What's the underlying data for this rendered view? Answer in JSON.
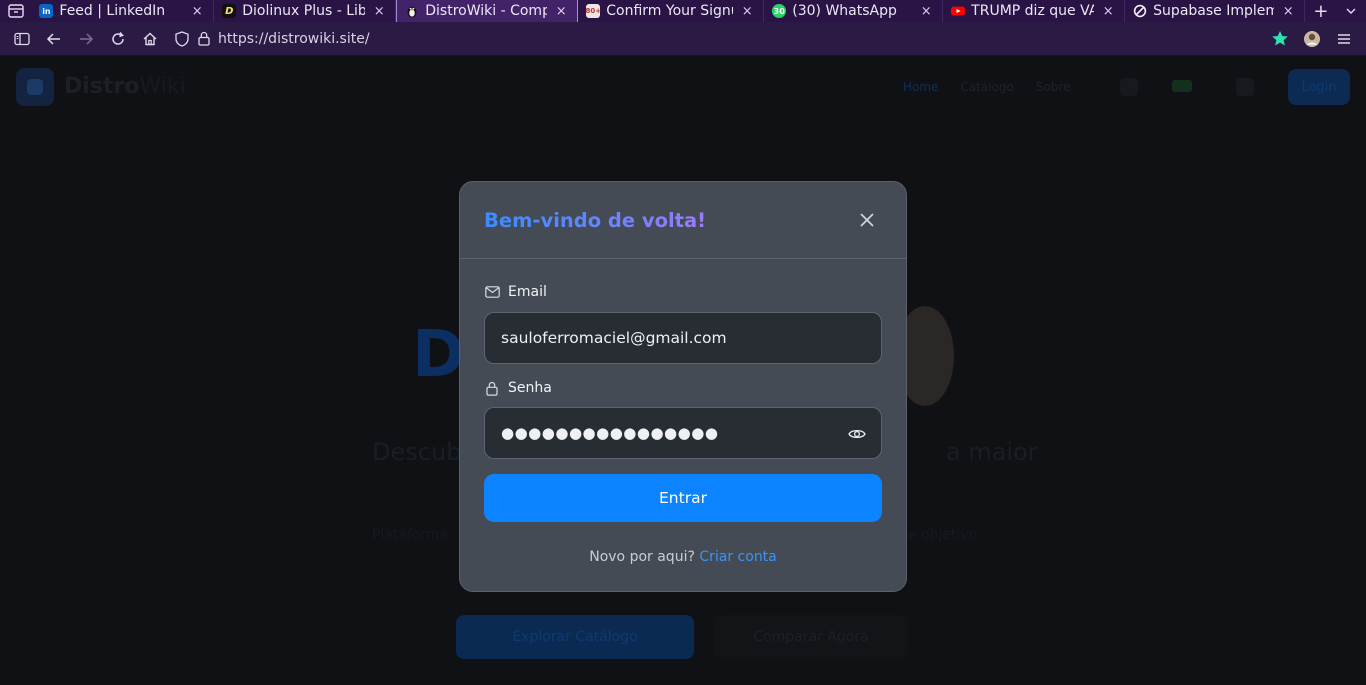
{
  "browser": {
    "tabs": [
      {
        "title": "Feed | LinkedIn",
        "favicon": "linkedin-icon",
        "active": false
      },
      {
        "title": "Diolinux Plus - Libe",
        "favicon": "diolinux-icon",
        "active": false
      },
      {
        "title": "DistroWiki - Compa",
        "favicon": "distrowiki-icon",
        "active": true
      },
      {
        "title": "Confirm Your Signu",
        "favicon": "mail-icon",
        "active": false
      },
      {
        "title": "(30) WhatsApp",
        "favicon": "whatsapp-icon",
        "badge": "30",
        "active": false
      },
      {
        "title": "TRUMP diz que VA",
        "favicon": "youtube-icon",
        "active": false
      },
      {
        "title": "Supabase Impleme",
        "favicon": "openai-icon",
        "active": false
      }
    ],
    "close_glyph": "×",
    "new_tab_glyph": "+",
    "url": "https://distrowiki.site/"
  },
  "background_page": {
    "hero_title_visible": "D",
    "hero_subtitle_left": "Descub",
    "hero_subtitle_right": "a maior",
    "hero_body_left": "Plataforma",
    "hero_body_right": "e objetivo.",
    "primary_button": "Explorar Catálogo",
    "secondary_button": "Comparar Agora",
    "nav": [
      "Home",
      "Catálogo",
      "Sobre"
    ],
    "login": "Login",
    "site_name": "Distro",
    "site_name_suffix": "Wiki"
  },
  "modal": {
    "title": "Bem-vindo de volta!",
    "email_label": "Email",
    "email_value": "sauloferromaciel@gmail.com",
    "password_label": "Senha",
    "password_mask": "●●●●●●●●●●●●●●●●",
    "submit_label": "Entrar",
    "footer_prompt": "Novo por aqui?",
    "footer_link": "Criar conta"
  },
  "colors": {
    "accent": "#0d84ff",
    "modal_bg": "#454b55",
    "link": "#3d93f3"
  }
}
